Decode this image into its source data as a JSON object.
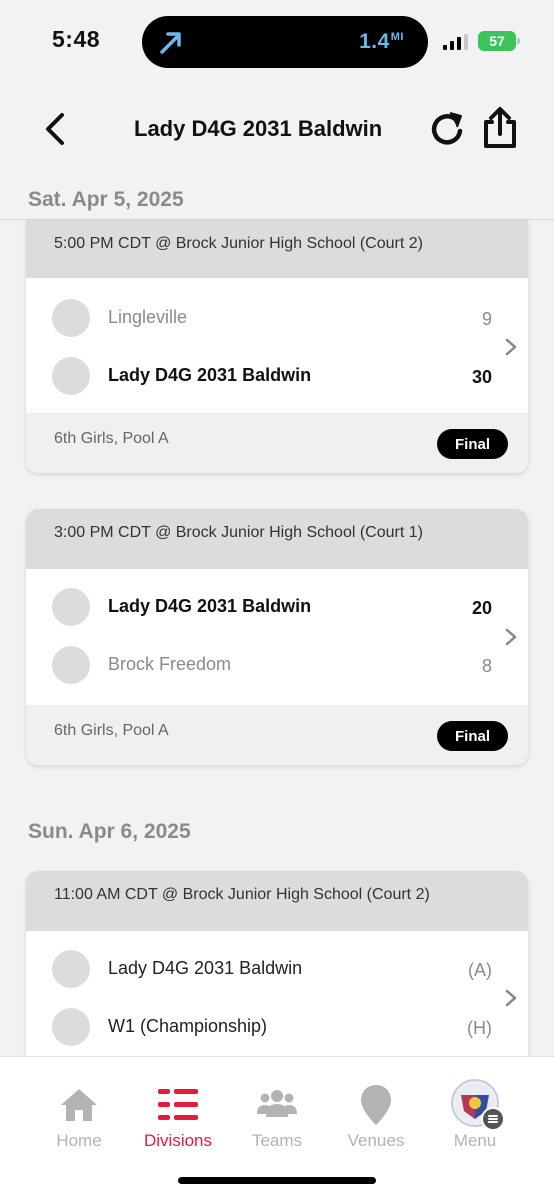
{
  "status_bar": {
    "time": "5:48",
    "distance": "1.4",
    "distance_unit": "MI",
    "battery": "57",
    "accent": "#6bb8ee"
  },
  "header": {
    "title": "Lady D4G 2031 Baldwin"
  },
  "sections": [
    {
      "date": "Sat. Apr 5, 2025",
      "games": [
        {
          "time_location": "5:00 PM CDT @ Brock Junior High School (Court 2)",
          "teams": [
            {
              "name": "Lingleville",
              "score": "9",
              "winner": false
            },
            {
              "name": "Lady D4G 2031 Baldwin",
              "score": "30",
              "winner": true
            }
          ],
          "pool": "6th Girls, Pool A",
          "status": "Final"
        },
        {
          "time_location": "3:00 PM CDT @ Brock Junior High School (Court 1)",
          "teams": [
            {
              "name": "Lady D4G 2031 Baldwin",
              "score": "20",
              "winner": true
            },
            {
              "name": "Brock Freedom",
              "score": "8",
              "winner": false
            }
          ],
          "pool": "6th Girls, Pool A",
          "status": "Final"
        }
      ]
    },
    {
      "date": "Sun. Apr 6, 2025",
      "games": [
        {
          "time_location": "11:00 AM CDT @ Brock Junior High School (Court 2)",
          "teams": [
            {
              "name": "Lady D4G 2031 Baldwin",
              "score": "(A)"
            },
            {
              "name": "W1 (Championship)",
              "score": "(H)"
            }
          ]
        }
      ]
    }
  ],
  "tab_bar": {
    "active_color": "#e31b3c",
    "inactive_color": "#b3b3b6",
    "tabs": [
      {
        "label": "Home",
        "icon": "home-icon",
        "active": false
      },
      {
        "label": "Divisions",
        "icon": "divisions-icon",
        "active": true
      },
      {
        "label": "Teams",
        "icon": "teams-icon",
        "active": false
      },
      {
        "label": "Venues",
        "icon": "venue-pin-icon",
        "active": false
      },
      {
        "label": "Menu",
        "icon": "menu-avatar",
        "active": false
      }
    ]
  }
}
